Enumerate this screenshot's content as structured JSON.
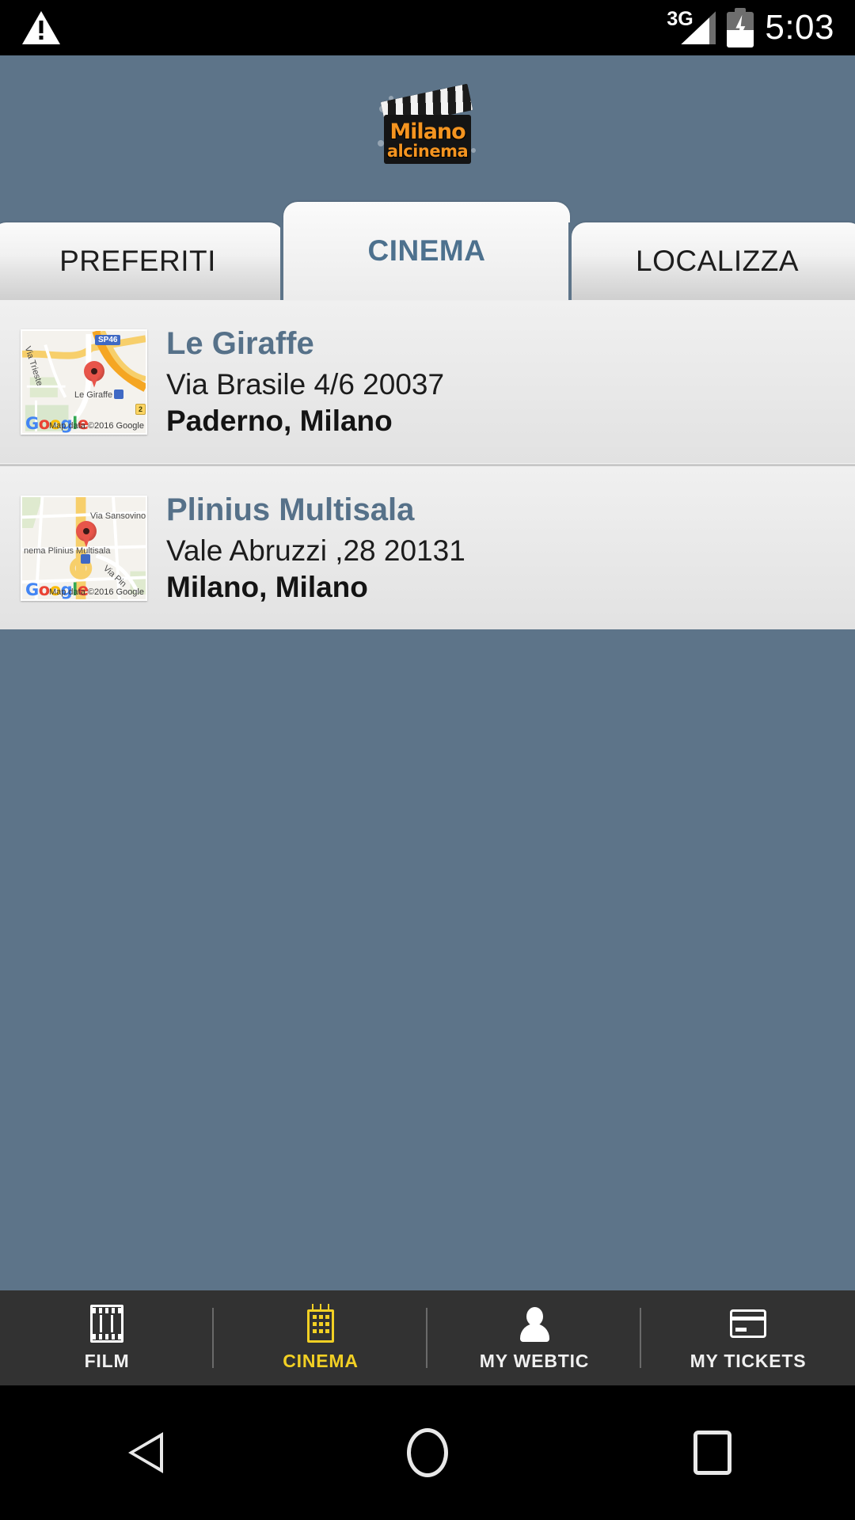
{
  "status_bar": {
    "warning_icon": "warning-triangle-icon",
    "network": "3G",
    "battery_icon": "battery-charging-icon",
    "time": "5:03"
  },
  "header": {
    "logo_line1": "Milano",
    "logo_line2": "alcinema",
    "logo_icon": "clapperboard-icon"
  },
  "tabs": [
    {
      "label": "PREFERITI",
      "active": false
    },
    {
      "label": "CINEMA",
      "active": true
    },
    {
      "label": "LOCALIZZA",
      "active": false
    }
  ],
  "cinemas": [
    {
      "name": "Le Giraffe",
      "address": "Via Brasile 4/6 20037",
      "city": "Paderno, Milano",
      "map": {
        "place_label": "Le Giraffe",
        "street_label": "Via Trieste",
        "highway_shield": "SP46",
        "exit_shield": "2",
        "attribution": "Map data ©2016 Google",
        "brand": "Google"
      }
    },
    {
      "name": "Plinius Multisala",
      "address": "Vale Abruzzi ,28 20131",
      "city": "Milano, Milano",
      "map": {
        "place_label": "nema Plinius Multisala",
        "street_label": "Via Sansovino",
        "street_label2": "Via Pin",
        "attribution": "Map data ©2016 Google",
        "brand": "Google"
      }
    }
  ],
  "bottom_nav": [
    {
      "label": "FILM",
      "icon": "film-strip-icon",
      "active": false
    },
    {
      "label": "CINEMA",
      "icon": "building-icon",
      "active": true
    },
    {
      "label": "MY WEBTIC",
      "icon": "person-icon",
      "active": false
    },
    {
      "label": "MY TICKETS",
      "icon": "credit-card-icon",
      "active": false
    }
  ],
  "android_nav": [
    {
      "name": "back-button",
      "icon": "triangle-left-icon"
    },
    {
      "name": "home-button",
      "icon": "circle-icon"
    },
    {
      "name": "recents-button",
      "icon": "square-icon"
    }
  ],
  "colors": {
    "app_background": "#5d7489",
    "accent_blue": "#567189",
    "accent_yellow": "#f2d024",
    "logo_orange": "#f49420"
  }
}
